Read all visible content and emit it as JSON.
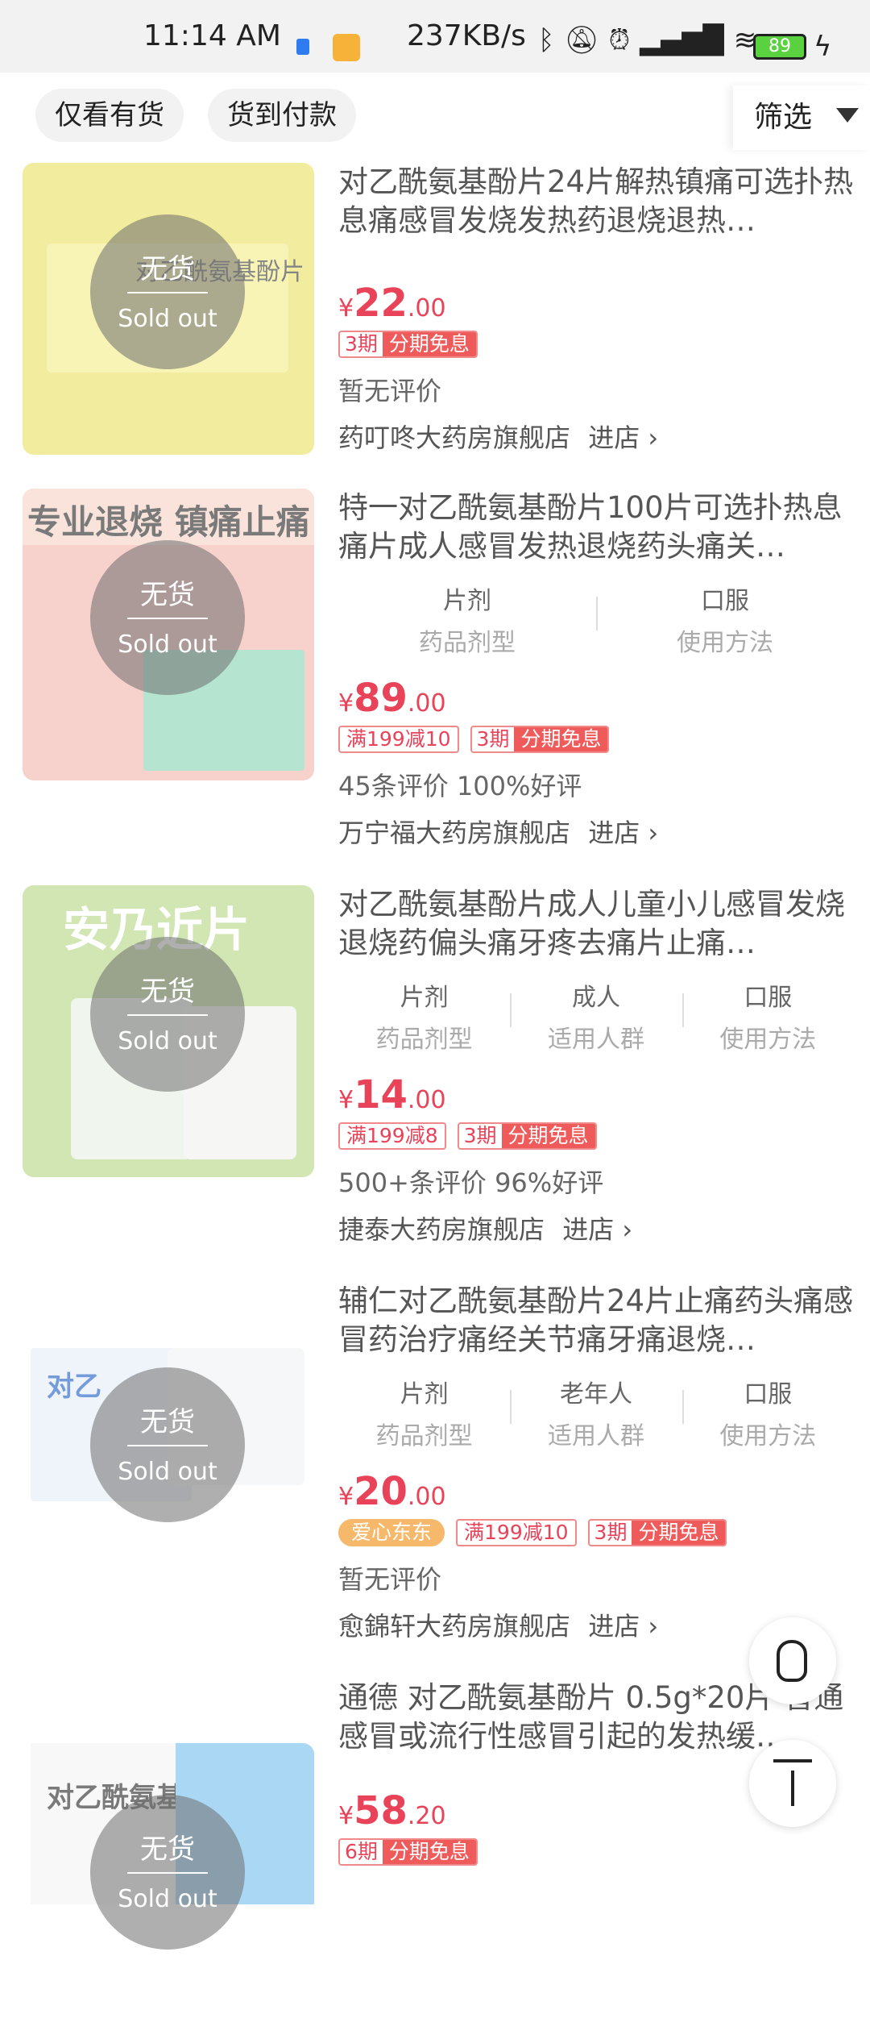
{
  "status_bar": {
    "time": "11:14 AM",
    "speed": "237KB/s",
    "battery": "89",
    "icons": [
      "bluetooth-icon",
      "mute-icon",
      "alarm-icon",
      "hd-signal-icon",
      "wifi-icon",
      "battery-icon",
      "charging-icon"
    ]
  },
  "filter_bar": {
    "chip_in_stock": "仅看有货",
    "chip_cod": "货到付款",
    "filter_label": "筛选"
  },
  "soldout": {
    "cn": "无货",
    "en": "Sold out"
  },
  "enter_store": "进店",
  "products": [
    {
      "title": "对乙酰氨基酚片24片解热镇痛可选扑热息痛感冒发烧发热药退烧退热…",
      "thumb_text": "对乙酰氨基酚片",
      "price_int": "22",
      "price_dec": ".00",
      "tags": [
        {
          "type": "split",
          "a": "3期",
          "b": "分期免息"
        }
      ],
      "reviews": "暂无评价",
      "shop": "药叮咚大药房旗舰店"
    },
    {
      "title": "特一对乙酰氨基酚片100片可选扑热息痛片成人感冒发热退烧药头痛关…",
      "thumb_text": "专业退烧 镇痛止痛",
      "specs": [
        {
          "v": "片剂",
          "k": "药品剂型"
        },
        {
          "v": "口服",
          "k": "使用方法"
        }
      ],
      "price_int": "89",
      "price_dec": ".00",
      "tags": [
        {
          "type": "outline",
          "text": "满199减10"
        },
        {
          "type": "split",
          "a": "3期",
          "b": "分期免息"
        }
      ],
      "reviews": "45条评价  100%好评",
      "shop": "万宁福大药房旗舰店"
    },
    {
      "title": "对乙酰氨基酚片成人儿童小儿感冒发烧退烧药偏头痛牙疼去痛片止痛…",
      "thumb_text": "安乃近片",
      "specs": [
        {
          "v": "片剂",
          "k": "药品剂型"
        },
        {
          "v": "成人",
          "k": "适用人群"
        },
        {
          "v": "口服",
          "k": "使用方法"
        }
      ],
      "price_int": "14",
      "price_dec": ".00",
      "tags": [
        {
          "type": "outline",
          "text": "满199减8"
        },
        {
          "type": "split",
          "a": "3期",
          "b": "分期免息"
        }
      ],
      "reviews": "500+条评价  96%好评",
      "shop": "捷泰大药房旗舰店"
    },
    {
      "title": "辅仁对乙酰氨基酚片24片止痛药头痛感冒药治疗痛经关节痛牙痛退烧…",
      "thumb_text": "对乙",
      "specs": [
        {
          "v": "片剂",
          "k": "药品剂型"
        },
        {
          "v": "老年人",
          "k": "适用人群"
        },
        {
          "v": "口服",
          "k": "使用方法"
        }
      ],
      "price_int": "20",
      "price_dec": ".00",
      "tags": [
        {
          "type": "love",
          "text": "爱心东东"
        },
        {
          "type": "outline",
          "text": "满199减10"
        },
        {
          "type": "split",
          "a": "3期",
          "b": "分期免息"
        }
      ],
      "reviews": "暂无评价",
      "shop": "愈錦轩大药房旗舰店"
    },
    {
      "title": "通德 对乙酰氨基酚片 0.5g*20片 普通感冒或流行性感冒引起的发热缓…",
      "thumb_text": "对乙酰氨基酚片",
      "price_int": "58",
      "price_dec": ".20",
      "tags": [
        {
          "type": "split",
          "a": "6期",
          "b": "分期免息"
        }
      ],
      "reviews": "",
      "shop": ""
    }
  ],
  "colors": {
    "price": "#e9435a",
    "accent_bg": "#f2f2f2"
  }
}
